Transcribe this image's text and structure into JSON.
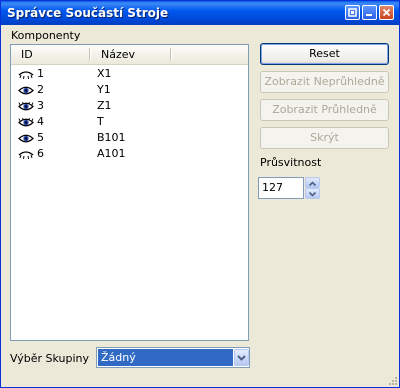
{
  "window": {
    "title": "Správce Součástí Stroje"
  },
  "components": {
    "label": "Komponenty",
    "columns": [
      "ID",
      "Název"
    ],
    "rows": [
      {
        "id": "1",
        "name": "X1",
        "eye": "closed-eye-icon"
      },
      {
        "id": "2",
        "name": "Y1",
        "eye": "open-eye-icon"
      },
      {
        "id": "3",
        "name": "Z1",
        "eye": "open-eye-icon"
      },
      {
        "id": "4",
        "name": "T",
        "eye": "open-eye-icon"
      },
      {
        "id": "5",
        "name": "B101",
        "eye": "open-eye-icon"
      },
      {
        "id": "6",
        "name": "A101",
        "eye": "closed-eye-icon"
      }
    ]
  },
  "buttons": {
    "reset": "Reset",
    "show_opaque": "Zobrazit Neprůhledně",
    "show_transparent": "Zobrazit Průhledně",
    "hide": "Skrýt"
  },
  "transparency": {
    "label": "Průsvitnost",
    "value": "127"
  },
  "group": {
    "label": "Výběr Skupiny",
    "selected": "Žádný"
  },
  "colors": {
    "titlebar": "#0054e3",
    "selection": "#316ac5",
    "disabled_text": "#aca899",
    "window_bg": "#ece9d8"
  }
}
